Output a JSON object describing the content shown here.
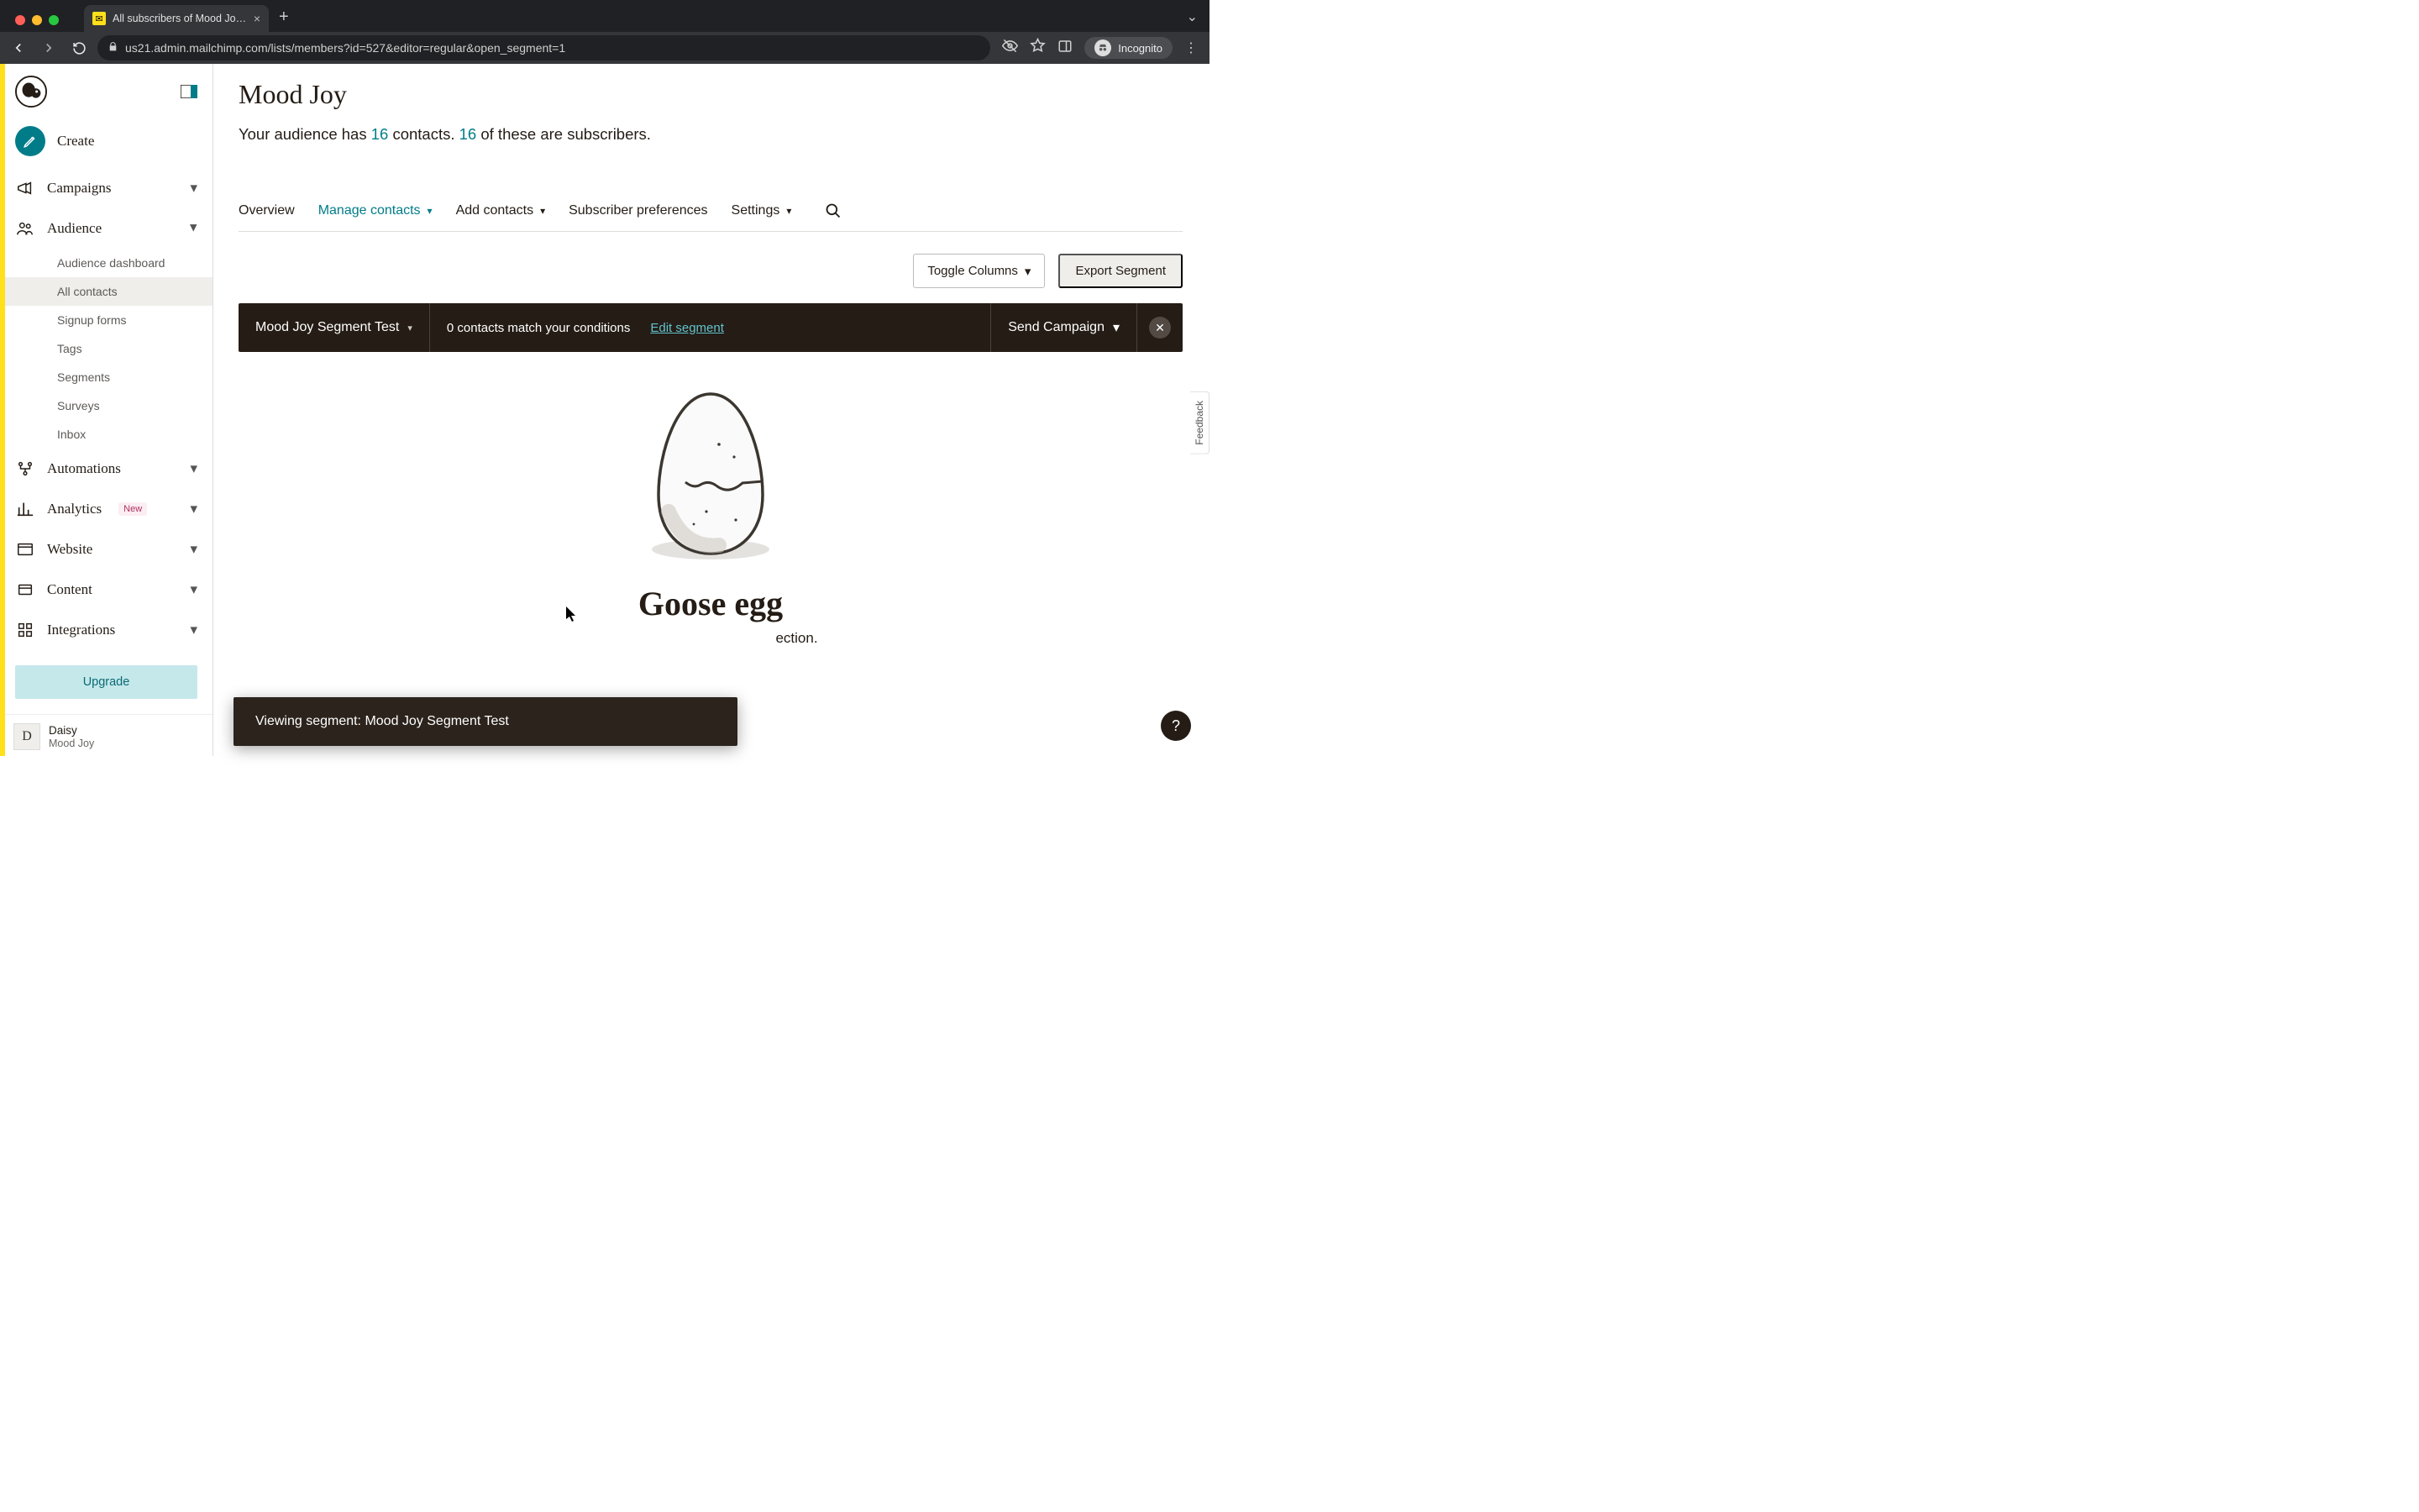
{
  "browser": {
    "tab_title": "All subscribers of Mood Joy | M",
    "url": "us21.admin.mailchimp.com/lists/members?id=527&editor=regular&open_segment=1",
    "incognito_label": "Incognito"
  },
  "sidebar": {
    "create_label": "Create",
    "items": [
      {
        "label": "Campaigns",
        "expanded": false
      },
      {
        "label": "Audience",
        "expanded": true,
        "children": [
          "Audience dashboard",
          "All contacts",
          "Signup forms",
          "Tags",
          "Segments",
          "Surveys",
          "Inbox"
        ],
        "selected_child": "All contacts"
      },
      {
        "label": "Automations",
        "expanded": false
      },
      {
        "label": "Analytics",
        "expanded": false,
        "badge": "New"
      },
      {
        "label": "Website",
        "expanded": false
      },
      {
        "label": "Content",
        "expanded": false
      },
      {
        "label": "Integrations",
        "expanded": false
      }
    ],
    "upgrade_label": "Upgrade",
    "user": {
      "initial": "D",
      "name": "Daisy",
      "org": "Mood Joy"
    }
  },
  "header": {
    "title": "Mood Joy",
    "line_prefix": "Your audience has ",
    "contacts": "16",
    "line_mid": " contacts. ",
    "subscribers": "16",
    "line_suffix": " of these are subscribers."
  },
  "tabs": {
    "overview": "Overview",
    "manage_contacts": "Manage contacts",
    "add_contacts": "Add contacts",
    "subscriber_prefs": "Subscriber preferences",
    "settings": "Settings"
  },
  "toolbar": {
    "toggle_columns": "Toggle Columns",
    "export_segment": "Export Segment"
  },
  "segment_bar": {
    "name": "Mood Joy Segment Test",
    "match_msg": "0 contacts match your conditions",
    "edit_label": "Edit segment",
    "send_label": "Send Campaign"
  },
  "empty": {
    "title": "Goose egg",
    "sub_fragment_right": "ection."
  },
  "toast": {
    "text": "Viewing segment: Mood Joy Segment Test"
  },
  "feedback": {
    "label": "Feedback"
  },
  "help": {
    "label": "?"
  }
}
